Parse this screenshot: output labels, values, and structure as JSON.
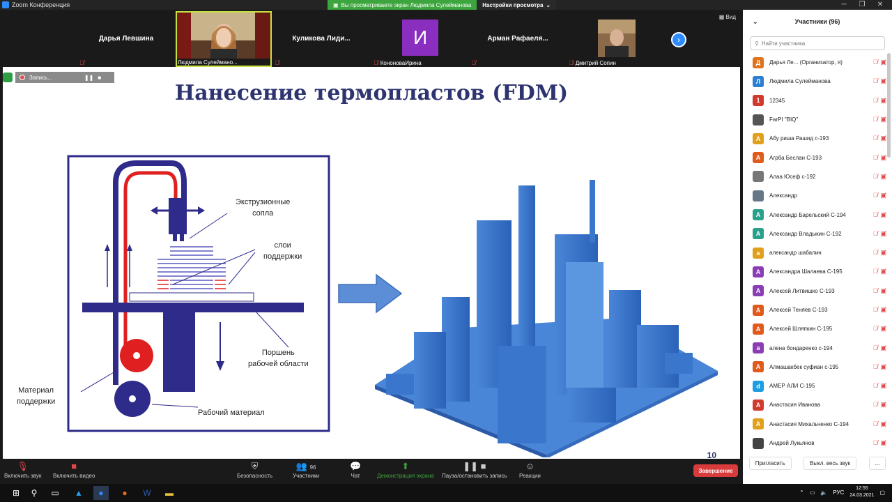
{
  "window": {
    "title": "Zoom Конференция"
  },
  "share_banner": {
    "text": "Вы просматриваете экран Людмила Сулейманова",
    "settings": "Настройки просмотра"
  },
  "video_tiles": [
    {
      "name": "Дарья Левшина",
      "sub": ""
    },
    {
      "name": "",
      "sub": "Людмила Сулейманo..."
    },
    {
      "name": "Куликова  Лиди...",
      "sub": ""
    },
    {
      "name": "",
      "sub": "КононоваИрина",
      "initial": "И"
    },
    {
      "name": "Арман  Рафаеля...",
      "sub": ""
    },
    {
      "name": "",
      "sub": "Дмитрий Сопин"
    }
  ],
  "view_button": "Вид",
  "recording": {
    "label": "Запись..."
  },
  "slide": {
    "title": "Нанесение термопластов (FDM)",
    "labels": {
      "nozzles_1": "Экструзионные",
      "nozzles_2": "сопла",
      "support_layers_1": "слои",
      "support_layers_2": "поддержки",
      "piston_1": "Поршень",
      "piston_2": "рабочей области",
      "support_material_1": "Материал",
      "support_material_2": "поддержки",
      "work_material": "Рабочий материал"
    },
    "page_number": "10"
  },
  "participants": {
    "header": "Участники (96)",
    "search_placeholder": "Найти участника",
    "list": [
      {
        "initial": "Д",
        "name": "Дарья Ле... (Организатор, я)",
        "color": "#e0731c"
      },
      {
        "initial": "Л",
        "name": "Людмила Сулейманова",
        "color": "#2d7fd1"
      },
      {
        "initial": "1",
        "name": "12345",
        "color": "#d13b2d"
      },
      {
        "initial": "",
        "name": "FarPI \"BIQ\"",
        "color": "#555555"
      },
      {
        "initial": "А",
        "name": "Абу риша Рашид с-193",
        "color": "#e0a01c"
      },
      {
        "initial": "А",
        "name": "Агрба Беслан  С-193",
        "color": "#e05a1c"
      },
      {
        "initial": "",
        "name": "Алаа Юсеф с-192",
        "color": "#777777"
      },
      {
        "initial": "",
        "name": "Александр",
        "color": "#667788"
      },
      {
        "initial": "А",
        "name": "Александр Барельский С-194",
        "color": "#2aa08a"
      },
      {
        "initial": "А",
        "name": "Александр Владыкин С-192",
        "color": "#2aa08a"
      },
      {
        "initial": "а",
        "name": "александр шабалин",
        "color": "#e0a01c"
      },
      {
        "initial": "А",
        "name": "Александра Шалаева С-195",
        "color": "#8a3db5"
      },
      {
        "initial": "А",
        "name": "Алексей Литвишко С-193",
        "color": "#8a3db5"
      },
      {
        "initial": "А",
        "name": "Алексей Теняев С-193",
        "color": "#e05a1c"
      },
      {
        "initial": "А",
        "name": "Алексей Шляпкин С-195",
        "color": "#e05a1c"
      },
      {
        "initial": "а",
        "name": "алена бондаренко с-194",
        "color": "#8a3db5"
      },
      {
        "initial": "А",
        "name": "Алмашакбек суфиан с-195",
        "color": "#e05a1c"
      },
      {
        "initial": "d",
        "name": "АМЕР АЛИ С-195",
        "color": "#1c9ee0"
      },
      {
        "initial": "А",
        "name": "Анастасия Иванова",
        "color": "#d13b2d"
      },
      {
        "initial": "А",
        "name": "Анастасия Михальченко С-194",
        "color": "#e0a01c"
      },
      {
        "initial": "",
        "name": "Андрей Лукьянов",
        "color": "#444444"
      }
    ],
    "invite": "Пригласить",
    "mute_all": "Выкл. весь звук",
    "more": "..."
  },
  "toolbar": {
    "mute": "Включить звук",
    "video": "Включить видео",
    "security": "Безопасность",
    "participants": "Участники",
    "participants_count": "96",
    "chat": "Чат",
    "share": "Демонстрация экрана",
    "record": "Пауза/остановить запись",
    "reactions": "Реакции",
    "end": "Завершение"
  },
  "taskbar": {
    "lang": "РУС",
    "time": "12:55",
    "date": "24.03.2021"
  }
}
